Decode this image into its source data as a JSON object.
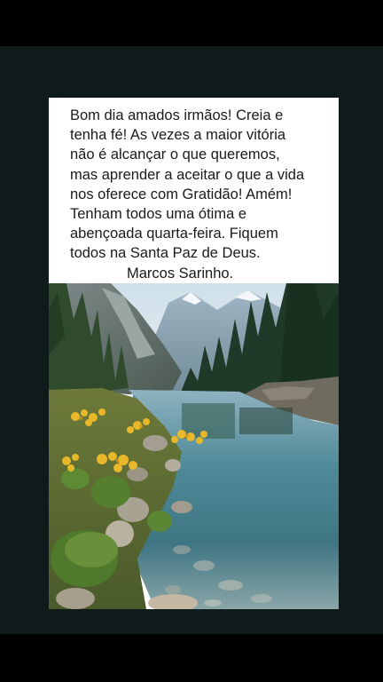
{
  "post": {
    "message_lines": [
      "Bom dia amados irmãos! Creia e",
      "tenha fé! As vezes a maior vitória",
      "não é alcançar o que queremos,",
      "mas aprender a aceitar o que a vida",
      "nos oferece com Gratidão! Amém!",
      "Tenham todos uma ótima e",
      "abençoada quarta-feira. Fiquem",
      "todos na Santa Paz de Deus."
    ],
    "signature": "Marcos Sarinho."
  },
  "colors": {
    "viewer_background": "#0f1a1b",
    "text": "#1a1a1a",
    "card": "#ffffff"
  }
}
